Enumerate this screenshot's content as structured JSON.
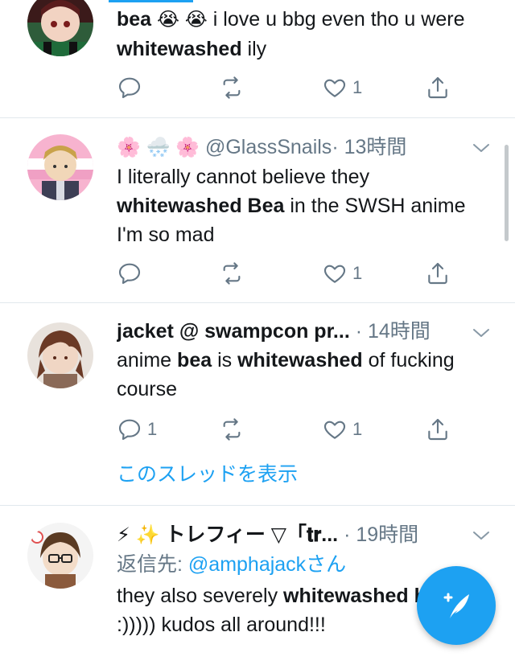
{
  "colors": {
    "accent": "#1da1f2",
    "text": "#14171a",
    "muted": "#657786",
    "divider": "#e1e8ed"
  },
  "tweets": [
    {
      "name": "bea",
      "name_emoji": "😭 😭",
      "text_parts": [
        "i love u bbg even tho u were ",
        "whitewashed",
        " ily"
      ],
      "reply_count": "",
      "like_count": "1"
    },
    {
      "name_emoji": "🌸 🌨️ 🌸",
      "handle": "@GlassSnails",
      "time": "· 13時間",
      "text_parts": [
        "I literally cannot believe they ",
        "whitewashed Bea",
        " in the SWSH anime I'm so mad"
      ],
      "reply_count": "",
      "like_count": "1"
    },
    {
      "name": "jacket @ swampcon pr...",
      "time": "· 14時間",
      "text_parts": [
        "anime ",
        "bea",
        " is ",
        "whitewashed",
        " of fucking course"
      ],
      "reply_count": "1",
      "like_count": "1",
      "thread_link": "このスレッドを表示"
    },
    {
      "name_emoji": "⚡ ✨",
      "name": "トレフィー ▽「𝐭𝐫...",
      "time": "· 19時間",
      "reply_prefix": "返信先: ",
      "reply_handle": "@amphajackさん",
      "text_parts": [
        "they also severely ",
        "whitewashed",
        " ",
        "bea",
        " :))))) kudos all around!!!"
      ]
    }
  ],
  "icons": [
    "reply-icon",
    "retweet-icon",
    "like-icon",
    "share-icon",
    "chevron-down-icon",
    "compose-icon"
  ]
}
